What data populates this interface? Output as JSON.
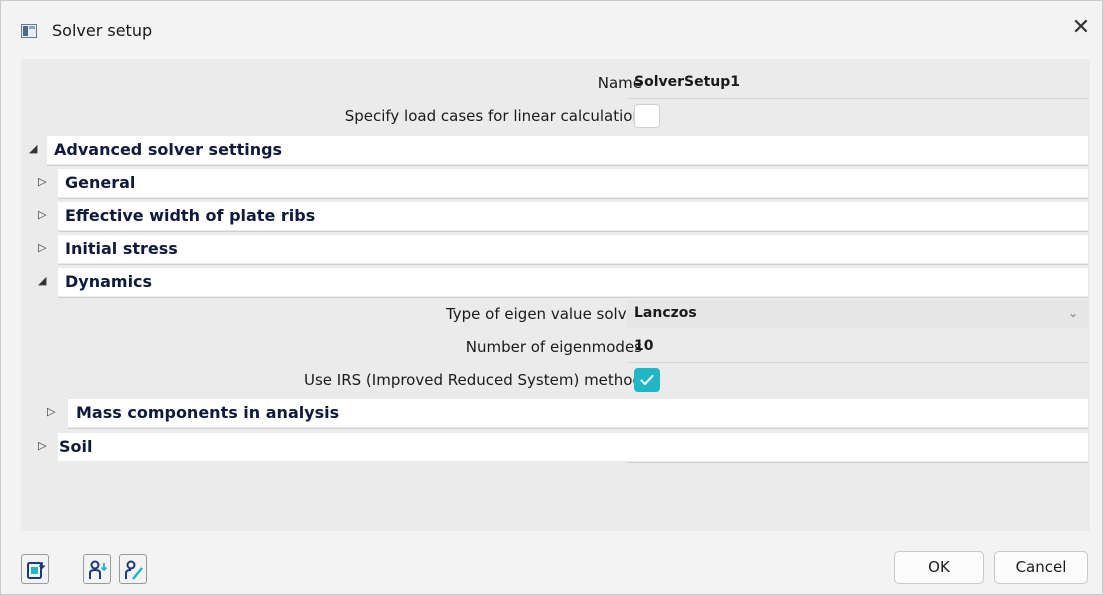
{
  "window": {
    "title": "Solver setup",
    "close_glyph": "✕"
  },
  "properties": {
    "name": {
      "label": "Name",
      "value": "SolverSetup1"
    },
    "specify_load_cases": {
      "label": "Specify load cases for linear calculation",
      "checked": false
    }
  },
  "groups": {
    "advanced": {
      "title": "Advanced solver settings",
      "expanded": true
    },
    "general": {
      "title": "General",
      "expanded": false
    },
    "effective_width": {
      "title": "Effective width of plate ribs",
      "expanded": false
    },
    "initial_stress": {
      "title": "Initial stress",
      "expanded": false
    },
    "dynamics": {
      "title": "Dynamics",
      "expanded": true
    },
    "mass_components": {
      "title": "Mass components in analysis",
      "expanded": false
    },
    "soil": {
      "title": "Soil",
      "expanded": false
    }
  },
  "dynamics": {
    "eigen_solver": {
      "label": "Type of eigen value solver",
      "value": "Lanczos"
    },
    "num_modes": {
      "label": "Number of eigenmodes",
      "value": "10"
    },
    "irs": {
      "label": "Use IRS (Improved Reduced System) method",
      "checked": true
    }
  },
  "glyphs": {
    "expanded": "◢",
    "collapsed": "▷",
    "dropdown": "⌄"
  },
  "toolbar": {
    "icons": [
      "export-icon",
      "user-add-icon",
      "user-edit-icon"
    ]
  },
  "buttons": {
    "ok": "OK",
    "cancel": "Cancel"
  },
  "colors": {
    "accent": "#1fb6c6",
    "group_title": "#0f1a3c",
    "panel": "#ebebeb"
  }
}
